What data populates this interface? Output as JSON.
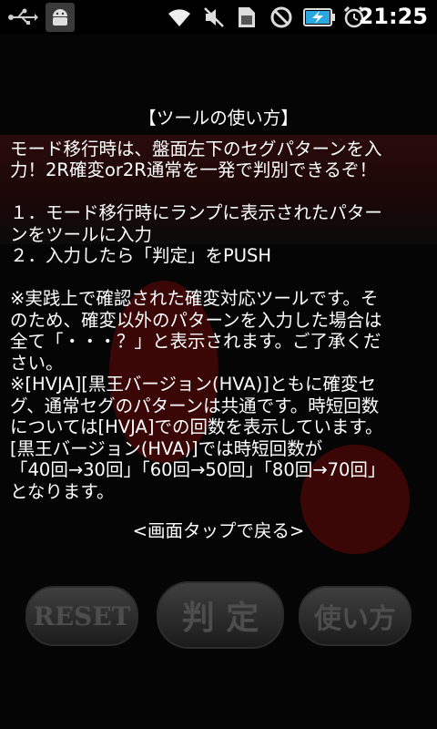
{
  "status_bar": {
    "time": "21:25",
    "icons": [
      "usb-icon",
      "android-debug-icon",
      "wifi-icon",
      "silent-icon",
      "sim-icon",
      "no-entry-icon",
      "battery-charging-icon",
      "alarm-icon"
    ]
  },
  "help": {
    "title": "【ツールの使い方】",
    "lines": [
      "モード移行時は、盤面左下のセグパターンを入",
      "力！2R確変or2R通常を一発で判別できるぞ！",
      "",
      "１．モード移行時にランプに表示されたパター",
      "ンをツールに入力",
      "２．入力したら「判定」をPUSH",
      "",
      "※実践上で確認された確変対応ツールです。そ",
      "のため、確変以外のパターンを入力した場合は",
      "全て「・・・？」と表示されます。ご了承くだ",
      "さい。",
      "※[HVJA][黒王バージョン(HVA)]ともに確変セ",
      "グ、通常セグのパターンは共通です。時短回数",
      "については[HVJA]での回数を表示しています。",
      "[黒王バージョン(HVA)]では時短回数が",
      "「40回→30回」「60回→50回」「80回→70回」",
      "となります。"
    ],
    "tap_hint": "<画面タップで戻る>"
  },
  "buttons": {
    "reset": "RESET",
    "judge": "判 定",
    "usage": "使い方"
  },
  "colors": {
    "background": "#000000",
    "text": "#ffffff",
    "battery": "#2aa7e0"
  }
}
